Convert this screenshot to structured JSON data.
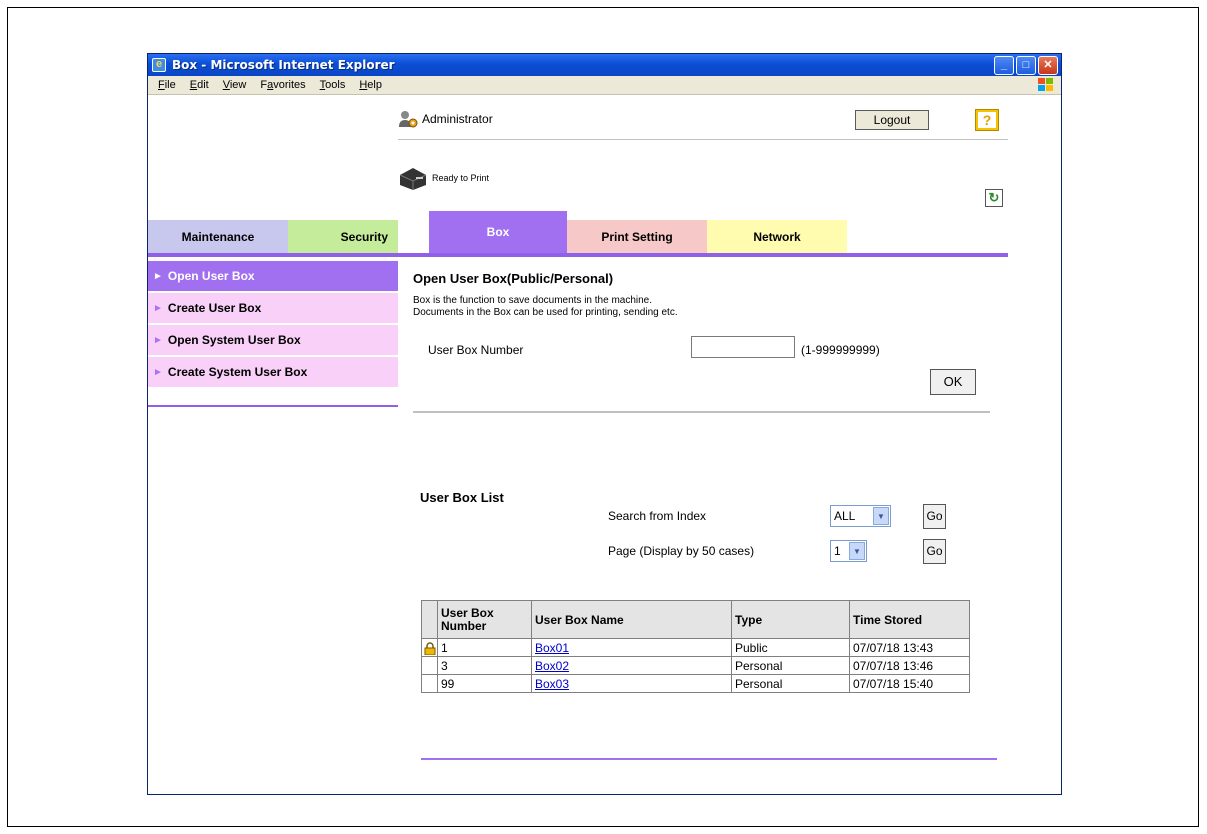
{
  "window": {
    "title": "Box - Microsoft Internet Explorer",
    "controls": {
      "minimize": "_",
      "maximize": "□",
      "close": "✕"
    }
  },
  "menubar": {
    "items": [
      {
        "pre": "",
        "key": "F",
        "post": "ile"
      },
      {
        "pre": "",
        "key": "E",
        "post": "dit"
      },
      {
        "pre": "",
        "key": "V",
        "post": "iew"
      },
      {
        "pre": "F",
        "key": "a",
        "post": "vorites"
      },
      {
        "pre": "",
        "key": "T",
        "post": "ools"
      },
      {
        "pre": "",
        "key": "H",
        "post": "elp"
      }
    ]
  },
  "header": {
    "user": "Administrator",
    "logout_label": "Logout",
    "help_label": "?",
    "status_text": "Ready to Print",
    "refresh_icon": "↻"
  },
  "tabs": {
    "maintenance": "Maintenance",
    "security": "Security",
    "box": "Box",
    "print_setting": "Print Setting",
    "network": "Network",
    "active": "Box"
  },
  "sidebar": {
    "arrow": "►",
    "items": [
      {
        "label": "Open User Box",
        "active": true
      },
      {
        "label": "Create User Box",
        "active": false
      },
      {
        "label": "Open System User Box",
        "active": false
      },
      {
        "label": "Create System User Box",
        "active": false
      }
    ]
  },
  "open_box": {
    "title": "Open User Box(Public/Personal)",
    "desc_line1": "Box is the function to save documents in the machine.",
    "desc_line2": "Documents in the Box can be used for printing, sending etc.",
    "number_label": "User Box Number",
    "number_value": "",
    "range": "(1-999999999)",
    "ok_label": "OK"
  },
  "box_list": {
    "title": "User Box List",
    "search_label": "Search from Index",
    "search_value": "ALL",
    "page_label": "Page (Display by 50 cases)",
    "page_value": "1",
    "go_label": "Go",
    "columns": [
      "User Box\nNumber",
      "User Box Name",
      "Type",
      "Time Stored"
    ],
    "rows": [
      {
        "locked": true,
        "number": "1",
        "name": "Box01",
        "type": "Public",
        "time": "07/07/18 13:43"
      },
      {
        "locked": false,
        "number": "3",
        "name": "Box02",
        "type": "Personal",
        "time": "07/07/18 13:46"
      },
      {
        "locked": false,
        "number": "99",
        "name": "Box03",
        "type": "Personal",
        "time": "07/07/18 15:40"
      }
    ]
  },
  "colors": {
    "accent": "#a070f0",
    "sidebar_bg": "#f8d0f8",
    "tab_maintenance": "#c8c8ee",
    "tab_security": "#c4ec9a",
    "tab_print": "#f6c8c8",
    "tab_network": "#fffcb0"
  }
}
